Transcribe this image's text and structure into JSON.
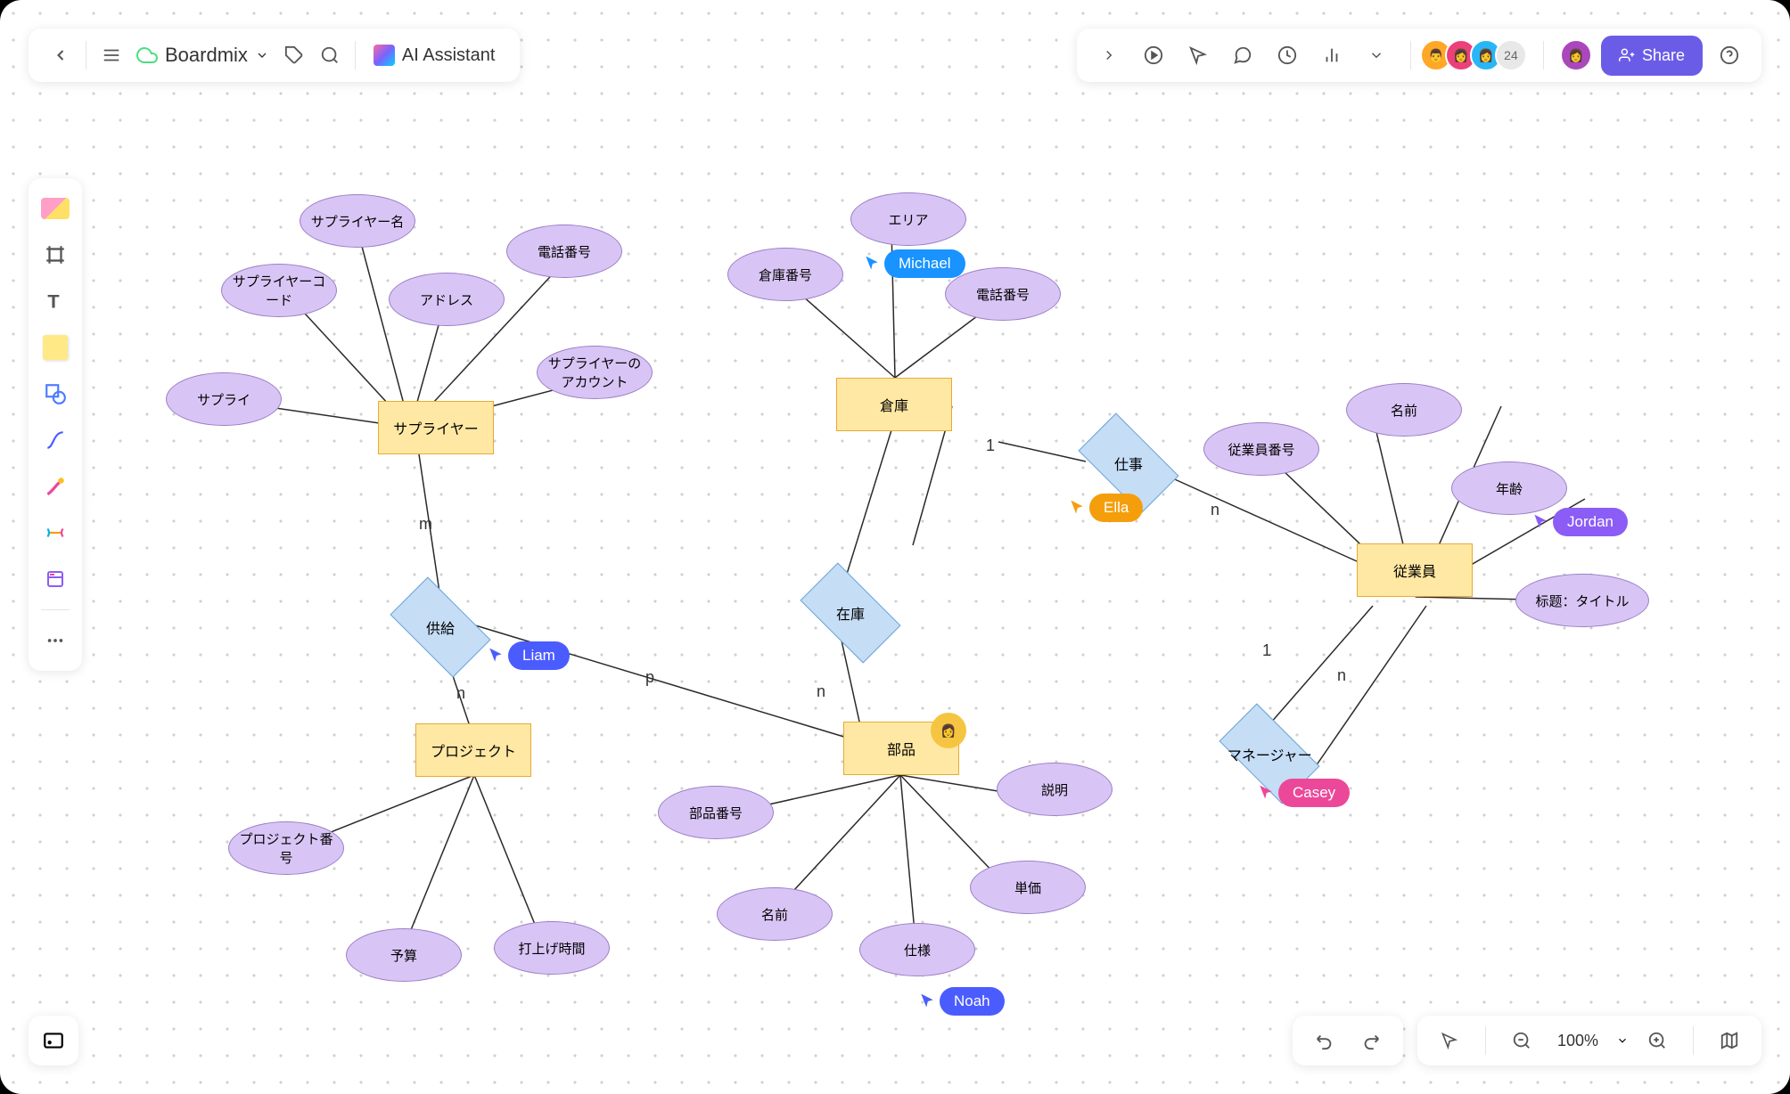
{
  "header": {
    "brand": "Boardmix",
    "ai": "AI Assistant",
    "avatarCount": "24",
    "share": "Share"
  },
  "zoom": {
    "value": "100%"
  },
  "entities": {
    "supplier": "サプライヤー",
    "warehouse": "倉庫",
    "employee": "従業員",
    "project": "プロジェクト",
    "parts": "部品"
  },
  "relations": {
    "supply": "供給",
    "work": "仕事",
    "stock": "在庫",
    "manager": "マネージャー"
  },
  "attrs": {
    "supplierName": "サプライヤー名",
    "supplierCode": "サプライヤーコード",
    "phone": "電話番号",
    "address": "アドレス",
    "supplierAccount": "サプライヤーのアカウント",
    "supply": "サプライ",
    "warehouseNo": "倉庫番号",
    "area": "エリア",
    "whPhone": "電話番号",
    "empNo": "従業員番号",
    "name": "名前",
    "age": "年齢",
    "title": "标题：タイトル",
    "projectNo": "プロジェクト番号",
    "budget": "予算",
    "launchTime": "打上げ時間",
    "partNo": "部品番号",
    "pname": "名前",
    "spec": "仕様",
    "unitPrice": "単価",
    "desc": "説明"
  },
  "cards": {
    "m": "m",
    "n": "n",
    "n2": "n",
    "n3": "n",
    "n4": "n",
    "one": "1",
    "one2": "1",
    "p": "p"
  },
  "cursors": {
    "michael": "Michael",
    "liam": "Liam",
    "noah": "Noah",
    "ella": "Ella",
    "casey": "Casey",
    "jordan": "Jordan"
  }
}
